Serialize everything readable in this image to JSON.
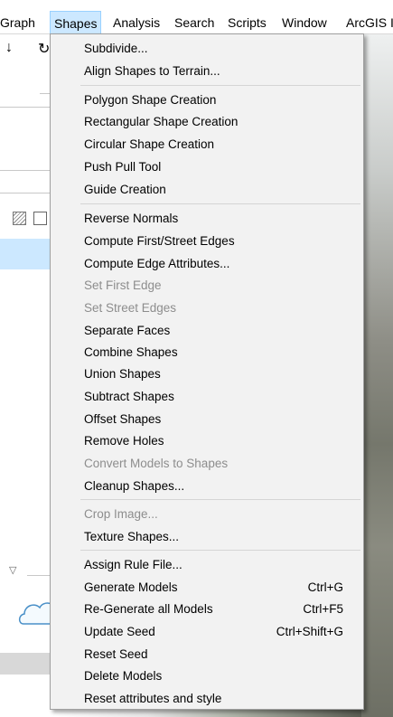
{
  "menubar": {
    "items": [
      {
        "label": "Graph"
      },
      {
        "label": "Shapes",
        "active": true
      },
      {
        "label": "Analysis"
      },
      {
        "label": "Search"
      },
      {
        "label": "Scripts"
      },
      {
        "label": "Window"
      },
      {
        "label": "ArcGIS I"
      }
    ]
  },
  "shapes_menu": {
    "items": [
      {
        "label": "Subdivide...",
        "enabled": true
      },
      {
        "label": "Align Shapes to Terrain...",
        "enabled": true
      },
      {
        "label": "Polygon Shape Creation",
        "enabled": true
      },
      {
        "label": "Rectangular Shape Creation",
        "enabled": true
      },
      {
        "label": "Circular Shape Creation",
        "enabled": true
      },
      {
        "label": "Push Pull Tool",
        "enabled": true
      },
      {
        "label": "Guide Creation",
        "enabled": true
      },
      {
        "label": "Reverse Normals",
        "enabled": true
      },
      {
        "label": "Compute First/Street Edges",
        "enabled": true
      },
      {
        "label": "Compute Edge Attributes...",
        "enabled": true
      },
      {
        "label": "Set First Edge",
        "enabled": false
      },
      {
        "label": "Set Street Edges",
        "enabled": false
      },
      {
        "label": "Separate Faces",
        "enabled": true
      },
      {
        "label": "Combine Shapes",
        "enabled": true
      },
      {
        "label": "Union Shapes",
        "enabled": true
      },
      {
        "label": "Subtract Shapes",
        "enabled": true
      },
      {
        "label": "Offset Shapes",
        "enabled": true
      },
      {
        "label": "Remove Holes",
        "enabled": true
      },
      {
        "label": "Convert Models to Shapes",
        "enabled": false
      },
      {
        "label": "Cleanup Shapes...",
        "enabled": true
      },
      {
        "label": "Crop Image...",
        "enabled": false
      },
      {
        "label": "Texture Shapes...",
        "enabled": true
      },
      {
        "label": "Assign Rule File...",
        "enabled": true
      },
      {
        "label": "Generate Models",
        "shortcut": "Ctrl+G",
        "enabled": true
      },
      {
        "label": "Re-Generate all Models",
        "shortcut": "Ctrl+F5",
        "enabled": true
      },
      {
        "label": "Update Seed",
        "shortcut": "Ctrl+Shift+G",
        "enabled": true
      },
      {
        "label": "Reset Seed",
        "enabled": true
      },
      {
        "label": "Delete Models",
        "enabled": true
      },
      {
        "label": "Reset attributes and style",
        "enabled": true
      }
    ]
  },
  "colors": {
    "menu_background": "#f2f2f2",
    "active_menu_highlight": "#cce8ff",
    "disabled_text": "#8d8d8d"
  }
}
